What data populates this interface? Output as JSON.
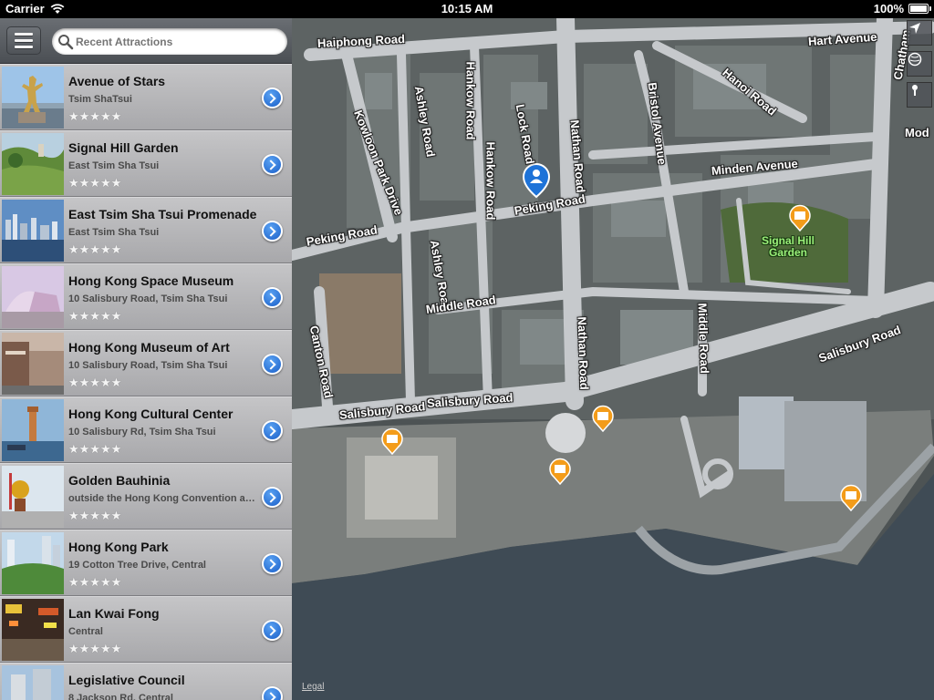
{
  "status_bar": {
    "carrier": "Carrier",
    "time": "10:15 AM",
    "battery": "100%"
  },
  "search": {
    "placeholder": "Recent Attractions",
    "value": ""
  },
  "attractions": [
    {
      "title": "Avenue of Stars",
      "subtitle": "Tsim ShaTsui",
      "rating": "★★★★★"
    },
    {
      "title": "Signal Hill Garden",
      "subtitle": "East Tsim Sha Tsui",
      "rating": "★★★★★"
    },
    {
      "title": "East Tsim Sha Tsui Promenade",
      "subtitle": "East Tsim Sha Tsui",
      "rating": "★★★★★"
    },
    {
      "title": "Hong Kong Space Museum",
      "subtitle": "10 Salisbury Road, Tsim Sha Tsui",
      "rating": "★★★★★"
    },
    {
      "title": "Hong Kong Museum of Art",
      "subtitle": "10 Salisbury Road, Tsim Sha Tsui",
      "rating": "★★★★★"
    },
    {
      "title": "Hong Kong Cultural Center",
      "subtitle": "10 Salisbury Rd, Tsim Sha Tsui",
      "rating": "★★★★★"
    },
    {
      "title": "Golden Bauhinia",
      "subtitle": "outside the Hong Kong Convention and Exhibition Centre",
      "rating": "★★★★★"
    },
    {
      "title": "Hong Kong Park",
      "subtitle": "19 Cotton Tree Drive, Central",
      "rating": "★★★★★"
    },
    {
      "title": "Lan Kwai Fong",
      "subtitle": "Central",
      "rating": "★★★★★"
    },
    {
      "title": "Legislative Council",
      "subtitle": "8 Jackson Rd, Central",
      "rating": "★★★★★"
    }
  ],
  "map": {
    "roads": {
      "haiphong": "Haiphong Road",
      "hankow": "Hankow Road",
      "hankow2": "Hankow Road",
      "ashley1": "Ashley Road",
      "ashley2": "Ashley Road",
      "lock": "Lock Road",
      "nathan1": "Nathan Road",
      "nathan2": "Nathan Road",
      "bristol": "Bristol Avenue",
      "hanoi": "Hanoi Road",
      "hart": "Hart Avenue",
      "chatham": "Chatham",
      "mody": "Mod",
      "kowloon_park": "Kowloon Park Drive",
      "peking1": "Peking Road",
      "peking2": "Peking Road",
      "minden": "Minden Avenue",
      "middle1": "Middle Road",
      "middle2": "Middle Road",
      "canton": "Canton Road",
      "salisbury1": "Salisbury Road",
      "salisbury2": "Salisbury Road",
      "salisbury3": "Salisbury Road"
    },
    "poi_label": "Signal Hill\nGarden",
    "legal": "Legal"
  },
  "colors": {
    "accent_blue": "#1a6fd6",
    "poi_orange": "#f39c1a",
    "poi_label_green": "#9bf07a"
  }
}
